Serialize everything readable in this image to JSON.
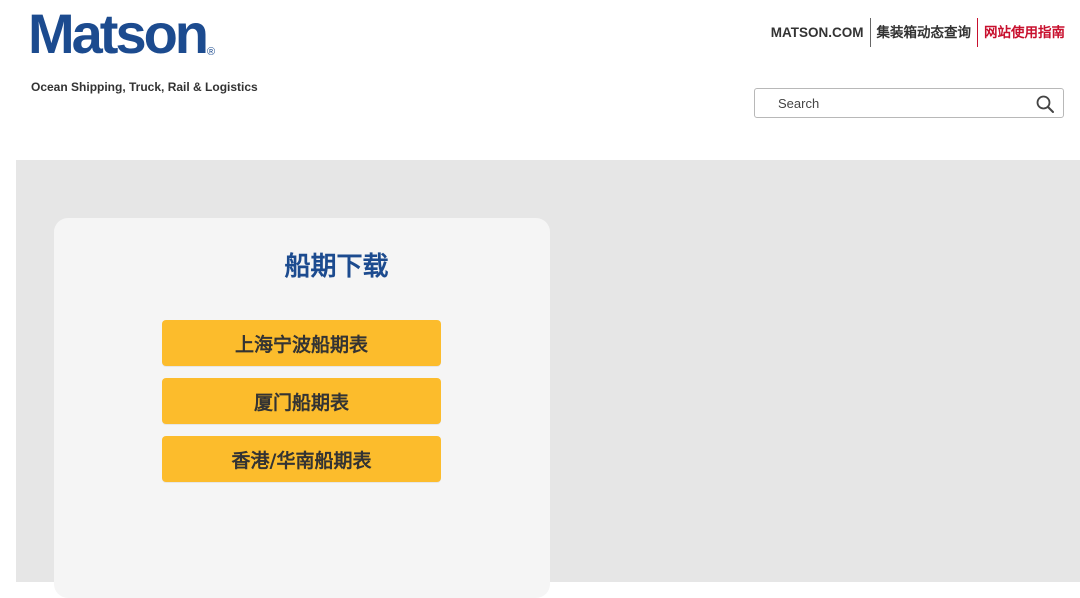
{
  "header": {
    "logo_text": "Matson",
    "logo_mark": "®",
    "tagline": "Ocean Shipping, Truck, Rail & Logistics",
    "links": [
      {
        "label": "MATSON.COM"
      },
      {
        "label": "集装箱动态查询"
      },
      {
        "label": "网站使用指南"
      }
    ],
    "search": {
      "placeholder": "Search",
      "icon": "search-icon"
    }
  },
  "main": {
    "card": {
      "title": "船期下载",
      "buttons": [
        {
          "label": "上海宁波船期表"
        },
        {
          "label": "厦门船期表"
        },
        {
          "label": "香港/华南船期表"
        }
      ]
    }
  },
  "colors": {
    "brand_blue": "#1c4b8f",
    "accent_red": "#c8102e",
    "button_yellow": "#fcbc2c",
    "page_gray": "#e6e6e6",
    "card_bg": "#f5f5f5"
  }
}
